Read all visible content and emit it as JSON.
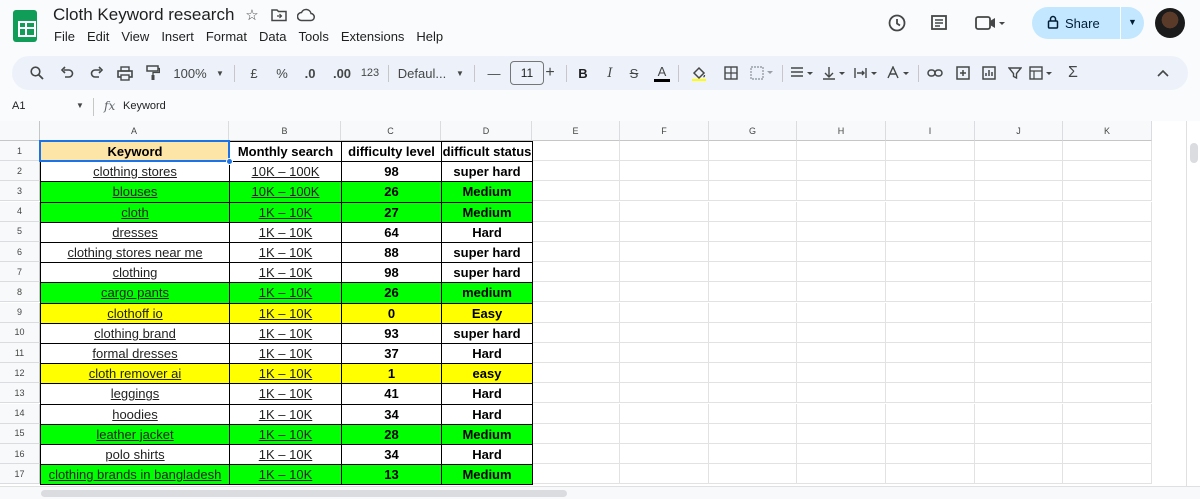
{
  "doc": {
    "title": "Cloth Keyword research",
    "menus": [
      "File",
      "Edit",
      "View",
      "Insert",
      "Format",
      "Data",
      "Tools",
      "Extensions",
      "Help"
    ],
    "share_label": "Share"
  },
  "toolbar": {
    "zoom": "100%",
    "currency": "£",
    "percent": "%",
    "dec_decrease": ".0",
    "dec_increase": ".00",
    "number_format": "123",
    "font": "Defaul...",
    "font_size": "11",
    "bold": "B",
    "italic": "I",
    "strike": "S",
    "text_color": "A",
    "minus": "—",
    "plus": "+",
    "sigma": "Σ"
  },
  "formula_bar": {
    "name_box": "A1",
    "fx": "fx",
    "content": "Keyword"
  },
  "columns": [
    "A",
    "B",
    "C",
    "D",
    "E",
    "F",
    "G",
    "H",
    "I",
    "J",
    "K"
  ],
  "rows": [
    "1",
    "2",
    "3",
    "4",
    "5",
    "6",
    "7",
    "8",
    "9",
    "10",
    "11",
    "12",
    "13",
    "14",
    "15",
    "16",
    "17"
  ],
  "colors": {
    "header_fill": "#fce5a7",
    "green": "#00ff00",
    "yellow": "#ffff00",
    "white": "#ffffff",
    "accent": "#1a73e8",
    "share_bg": "#c2e7ff"
  },
  "table": {
    "headers": [
      "Keyword",
      "Monthly search",
      "difficulty level",
      "difficult status"
    ],
    "rows": [
      {
        "keyword": "clothing stores",
        "search": "10K – 100K",
        "level": "98",
        "status": "super hard",
        "fill": "white"
      },
      {
        "keyword": "blouses",
        "search": "10K – 100K",
        "level": "26",
        "status": "Medium",
        "fill": "green"
      },
      {
        "keyword": "cloth",
        "search": "1K – 10K",
        "level": "27",
        "status": "Medium",
        "fill": "green"
      },
      {
        "keyword": "dresses",
        "search": "1K – 10K",
        "level": "64",
        "status": "Hard",
        "fill": "white"
      },
      {
        "keyword": "clothing stores near me",
        "search": "1K – 10K",
        "level": "88",
        "status": "super hard",
        "fill": "white"
      },
      {
        "keyword": "clothing",
        "search": "1K – 10K",
        "level": "98",
        "status": "super hard",
        "fill": "white"
      },
      {
        "keyword": "cargo pants",
        "search": "1K – 10K",
        "level": "26",
        "status": "medium",
        "fill": "green"
      },
      {
        "keyword": "clothoff io",
        "search": "1K – 10K",
        "level": "0",
        "status": "Easy",
        "fill": "yellow"
      },
      {
        "keyword": "clothing brand",
        "search": "1K – 10K",
        "level": "93",
        "status": "super hard",
        "fill": "white"
      },
      {
        "keyword": "formal dresses",
        "search": "1K – 10K",
        "level": "37",
        "status": "Hard",
        "fill": "white"
      },
      {
        "keyword": "cloth remover ai",
        "search": "1K – 10K",
        "level": "1",
        "status": "easy",
        "fill": "yellow"
      },
      {
        "keyword": "leggings",
        "search": "1K – 10K",
        "level": "41",
        "status": "Hard",
        "fill": "white"
      },
      {
        "keyword": "hoodies",
        "search": "1K – 10K",
        "level": "34",
        "status": "Hard",
        "fill": "white"
      },
      {
        "keyword": "leather jacket",
        "search": "1K – 10K",
        "level": "28",
        "status": "Medium",
        "fill": "green"
      },
      {
        "keyword": "polo shirts",
        "search": "1K – 10K",
        "level": "34",
        "status": "Hard",
        "fill": "white"
      },
      {
        "keyword": "clothing brands in bangladesh",
        "search": "1K – 10K",
        "level": "13",
        "status": "Medium",
        "fill": "green"
      }
    ]
  }
}
